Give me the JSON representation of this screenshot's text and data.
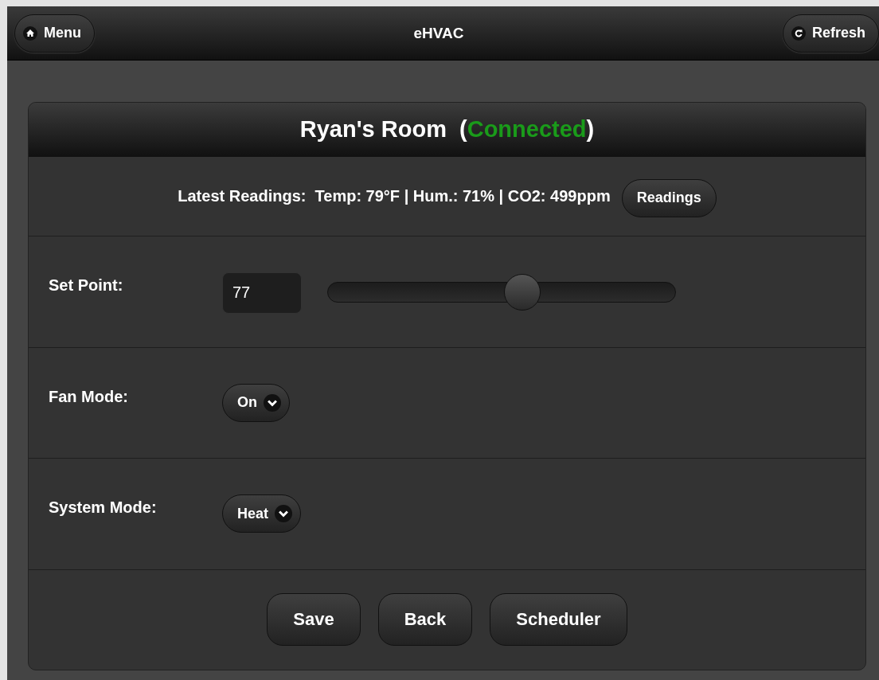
{
  "header": {
    "menu_button": "Menu",
    "title": "eHVAC",
    "refresh_button": "Refresh"
  },
  "room": {
    "name": "Ryan's Room  (",
    "status": "Connected",
    "closing": ")",
    "connected": true
  },
  "readings": {
    "text": "Latest Readings:  Temp: 79°F | Hum.: 71% | CO2: 499ppm",
    "button": "Readings"
  },
  "settings": [
    {
      "kind": "slider",
      "label": "Set Point:",
      "value": "77",
      "level": 0.56
    },
    {
      "kind": "select",
      "label": "Fan Mode:",
      "value": "On"
    },
    {
      "kind": "select",
      "label": "System Mode:",
      "value": "Heat"
    }
  ],
  "buttons": [
    "Save",
    "Back",
    "Scheduler"
  ]
}
